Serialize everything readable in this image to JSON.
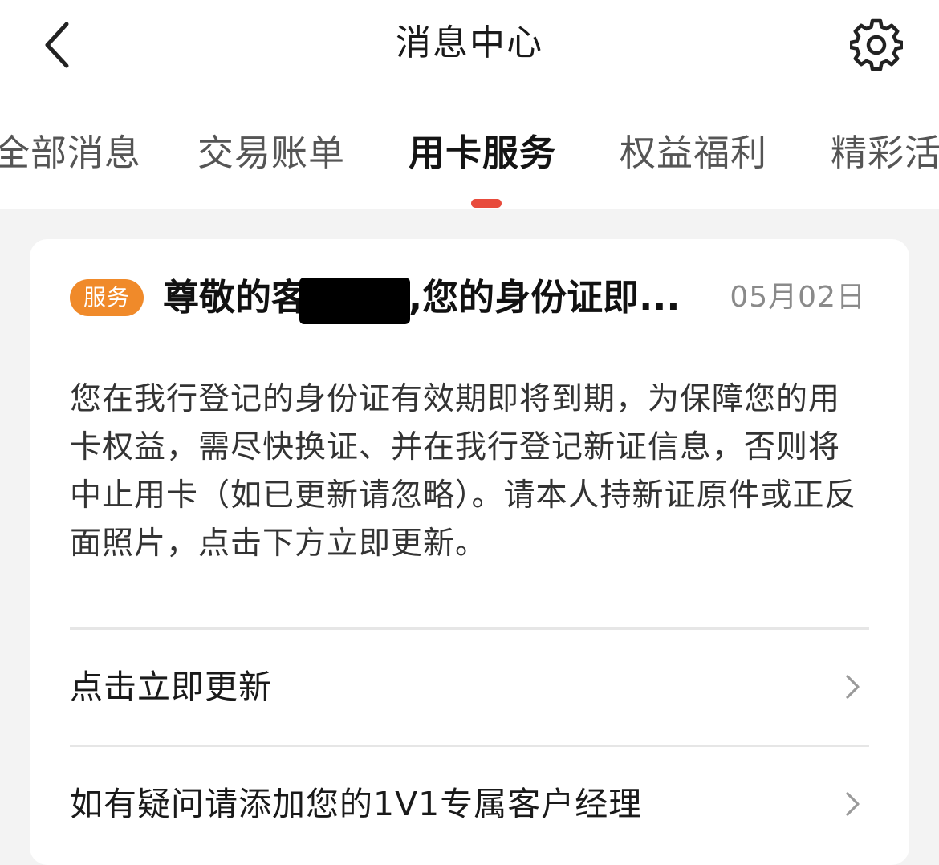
{
  "header": {
    "title": "消息中心",
    "back_icon": "chevron-left-icon",
    "settings_icon": "gear-icon"
  },
  "tabs": [
    {
      "label": "全部消息",
      "active": false
    },
    {
      "label": "交易账单",
      "active": false
    },
    {
      "label": "用卡服务",
      "active": true
    },
    {
      "label": "权益福利",
      "active": false
    },
    {
      "label": "精彩活",
      "active": false
    }
  ],
  "message": {
    "badge": "服务",
    "title_prefix": "尊敬的",
    "title_redacted_char": "客",
    "title_suffix": ",您的身份证即...",
    "date": "05月02日",
    "body": "您在我行登记的身份证有效期即将到期，为保障您的用卡权益，需尽快换证、并在我行登记新证信息，否则将中止用卡（如已更新请忽略）。请本人持新证原件或正反面照片，点击下方立即更新。",
    "actions": [
      {
        "label": "点击立即更新",
        "icon": "chevron-right-icon"
      },
      {
        "label": "如有疑问请添加您的1V1专属客户经理",
        "icon": "chevron-right-icon"
      }
    ]
  },
  "colors": {
    "accent": "#e84b3c",
    "badge": "#f08a2a",
    "background": "#f3f3f3",
    "card": "#ffffff"
  }
}
